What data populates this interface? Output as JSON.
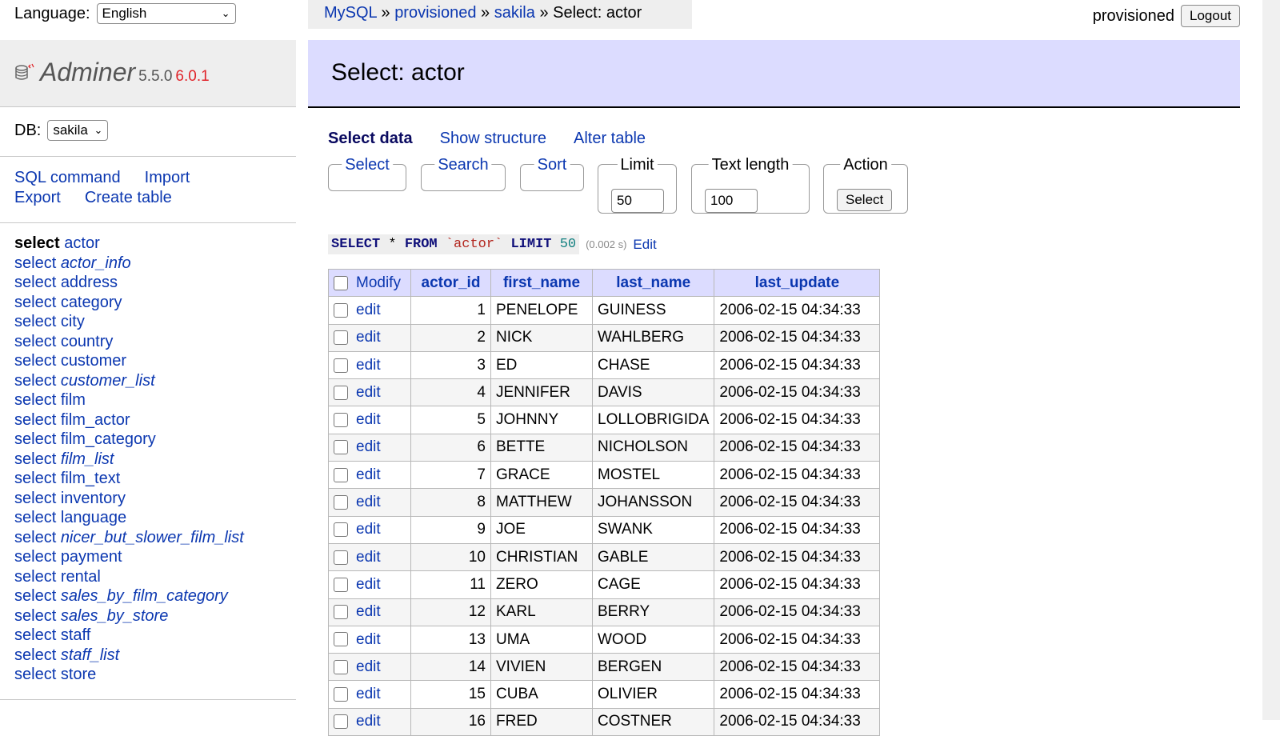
{
  "language": {
    "label": "Language:",
    "selected": "English"
  },
  "brand": {
    "name": "Adminer",
    "version": "5.5.0",
    "new_version": "6.0.1"
  },
  "db": {
    "label": "DB:",
    "selected": "sakila"
  },
  "commands": {
    "sql_command": "SQL command",
    "import": "Import",
    "export": "Export",
    "create_table": "Create table"
  },
  "tables": [
    {
      "action": "select",
      "name": "actor",
      "view": false,
      "active": true
    },
    {
      "action": "select",
      "name": "actor_info",
      "view": true,
      "active": false
    },
    {
      "action": "select",
      "name": "address",
      "view": false,
      "active": false
    },
    {
      "action": "select",
      "name": "category",
      "view": false,
      "active": false
    },
    {
      "action": "select",
      "name": "city",
      "view": false,
      "active": false
    },
    {
      "action": "select",
      "name": "country",
      "view": false,
      "active": false
    },
    {
      "action": "select",
      "name": "customer",
      "view": false,
      "active": false
    },
    {
      "action": "select",
      "name": "customer_list",
      "view": true,
      "active": false
    },
    {
      "action": "select",
      "name": "film",
      "view": false,
      "active": false
    },
    {
      "action": "select",
      "name": "film_actor",
      "view": false,
      "active": false
    },
    {
      "action": "select",
      "name": "film_category",
      "view": false,
      "active": false
    },
    {
      "action": "select",
      "name": "film_list",
      "view": true,
      "active": false
    },
    {
      "action": "select",
      "name": "film_text",
      "view": false,
      "active": false
    },
    {
      "action": "select",
      "name": "inventory",
      "view": false,
      "active": false
    },
    {
      "action": "select",
      "name": "language",
      "view": false,
      "active": false
    },
    {
      "action": "select",
      "name": "nicer_but_slower_film_list",
      "view": true,
      "active": false
    },
    {
      "action": "select",
      "name": "payment",
      "view": false,
      "active": false
    },
    {
      "action": "select",
      "name": "rental",
      "view": false,
      "active": false
    },
    {
      "action": "select",
      "name": "sales_by_film_category",
      "view": true,
      "active": false
    },
    {
      "action": "select",
      "name": "sales_by_store",
      "view": true,
      "active": false
    },
    {
      "action": "select",
      "name": "staff",
      "view": false,
      "active": false
    },
    {
      "action": "select",
      "name": "staff_list",
      "view": true,
      "active": false
    },
    {
      "action": "select",
      "name": "store",
      "view": false,
      "active": false
    }
  ],
  "breadcrumb": {
    "driver": "MySQL",
    "server": "provisioned",
    "database": "sakila",
    "current": "Select: actor",
    "separator": "»"
  },
  "user": {
    "name": "provisioned",
    "logout": "Logout"
  },
  "page_title": "Select: actor",
  "tabs": {
    "select_data": "Select data",
    "show_structure": "Show structure",
    "alter_table": "Alter table"
  },
  "form": {
    "select_legend": "Select",
    "search_legend": "Search",
    "sort_legend": "Sort",
    "limit_legend": "Limit",
    "limit_value": "50",
    "text_length_legend": "Text length",
    "text_length_value": "100",
    "action_legend": "Action",
    "action_button": "Select"
  },
  "query": {
    "select_kw": "SELECT",
    "star": "*",
    "from_kw": "FROM",
    "table": "`actor`",
    "limit_kw": "LIMIT",
    "limit_num": "50",
    "timing": "(0.002 s)",
    "edit_link": "Edit"
  },
  "grid": {
    "modify_label": "Modify",
    "edit_label": "edit",
    "columns": [
      "actor_id",
      "first_name",
      "last_name",
      "last_update"
    ],
    "rows": [
      [
        "1",
        "PENELOPE",
        "GUINESS",
        "2006-02-15 04:34:33"
      ],
      [
        "2",
        "NICK",
        "WAHLBERG",
        "2006-02-15 04:34:33"
      ],
      [
        "3",
        "ED",
        "CHASE",
        "2006-02-15 04:34:33"
      ],
      [
        "4",
        "JENNIFER",
        "DAVIS",
        "2006-02-15 04:34:33"
      ],
      [
        "5",
        "JOHNNY",
        "LOLLOBRIGIDA",
        "2006-02-15 04:34:33"
      ],
      [
        "6",
        "BETTE",
        "NICHOLSON",
        "2006-02-15 04:34:33"
      ],
      [
        "7",
        "GRACE",
        "MOSTEL",
        "2006-02-15 04:34:33"
      ],
      [
        "8",
        "MATTHEW",
        "JOHANSSON",
        "2006-02-15 04:34:33"
      ],
      [
        "9",
        "JOE",
        "SWANK",
        "2006-02-15 04:34:33"
      ],
      [
        "10",
        "CHRISTIAN",
        "GABLE",
        "2006-02-15 04:34:33"
      ],
      [
        "11",
        "ZERO",
        "CAGE",
        "2006-02-15 04:34:33"
      ],
      [
        "12",
        "KARL",
        "BERRY",
        "2006-02-15 04:34:33"
      ],
      [
        "13",
        "UMA",
        "WOOD",
        "2006-02-15 04:34:33"
      ],
      [
        "14",
        "VIVIEN",
        "BERGEN",
        "2006-02-15 04:34:33"
      ],
      [
        "15",
        "CUBA",
        "OLIVIER",
        "2006-02-15 04:34:33"
      ],
      [
        "16",
        "FRED",
        "COSTNER",
        "2006-02-15 04:34:33"
      ]
    ]
  }
}
